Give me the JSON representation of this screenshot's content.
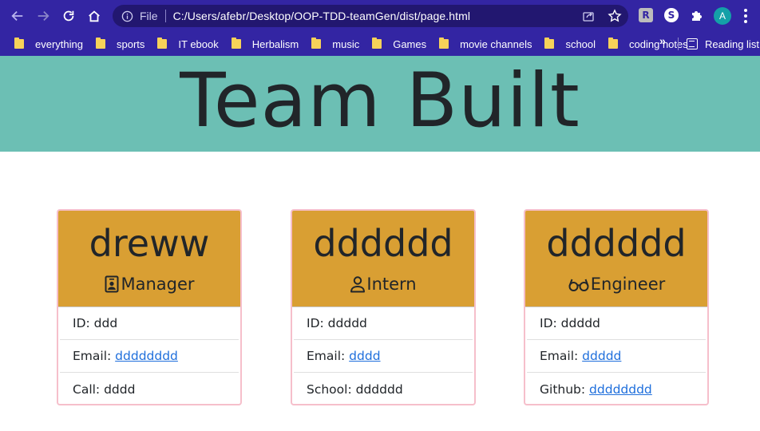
{
  "browser": {
    "url_scheme": "File",
    "url": "C:/Users/afebr/Desktop/OOP-TDD-teamGen/dist/page.html",
    "profile_initial": "A",
    "extensions": [
      "R",
      "S"
    ],
    "bookmarks": [
      "everything",
      "sports",
      "IT ebook",
      "Herbalism",
      "music",
      "Games",
      "movie channels",
      "school",
      "coding notes"
    ],
    "more_label": "»",
    "reading_list": "Reading list"
  },
  "page": {
    "title": "Team Built"
  },
  "team": [
    {
      "name": "dreww",
      "role": "Manager",
      "role_icon": "person-badge-icon",
      "id_label": "ID: ",
      "id": "ddd",
      "email_label": "Email: ",
      "email": "dddddddd",
      "extra_label": "Call: ",
      "extra": "dddd"
    },
    {
      "name": "dddddd",
      "role": "Intern",
      "role_icon": "person-icon",
      "id_label": "ID: ",
      "id": "ddddd",
      "email_label": "Email: ",
      "email": "dddd",
      "extra_label": "School: ",
      "extra": "dddddd"
    },
    {
      "name": "dddddd",
      "role": "Engineer",
      "role_icon": "eyeglasses-icon",
      "id_label": "ID: ",
      "id": "ddddd",
      "email_label": "Email: ",
      "email": "ddddd",
      "extra_label": "Github: ",
      "extra": "dddddddd"
    }
  ],
  "colors": {
    "browser_chrome": "#3325a3",
    "header_bg": "#6cbfb4",
    "card_header": "#d99f33",
    "card_border": "#f6bfcb",
    "link": "#1f6fdc"
  }
}
